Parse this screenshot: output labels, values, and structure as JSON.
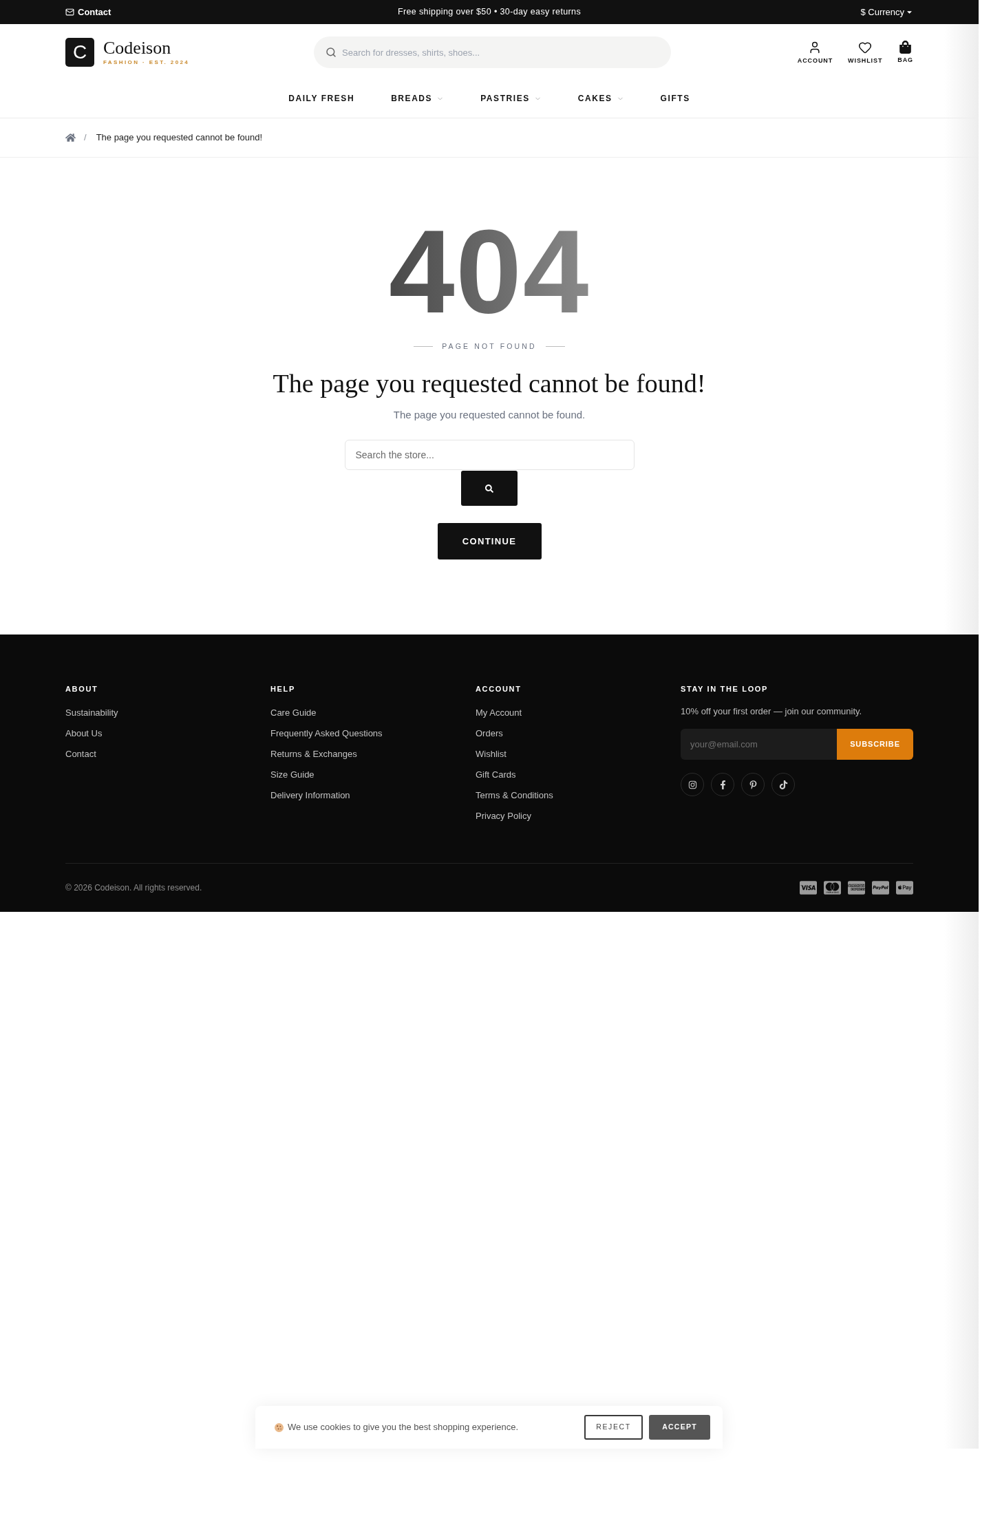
{
  "top_bar": {
    "contact": "Contact",
    "promo": "Free shipping over $50 • 30-day easy returns",
    "currency": "$ Currency"
  },
  "header": {
    "logo": {
      "letter": "C",
      "name": "Codeison",
      "tagline": "FASHION · EST. 2024"
    },
    "search": {
      "placeholder": "Search for dresses, shirts, shoes..."
    },
    "actions": [
      {
        "label": "ACCOUNT",
        "kind": "account"
      },
      {
        "label": "WISHLIST",
        "kind": "wishlist"
      },
      {
        "label": "BAG",
        "kind": "bag"
      }
    ]
  },
  "nav": [
    {
      "label": "DAILY FRESH",
      "dropdown": false
    },
    {
      "label": "BREADS",
      "dropdown": true
    },
    {
      "label": "PASTRIES",
      "dropdown": true
    },
    {
      "label": "CAKES",
      "dropdown": true
    },
    {
      "label": "GIFTS",
      "dropdown": false
    }
  ],
  "breadcrumb": {
    "separator": "/",
    "current": "The page you requested cannot be found!"
  },
  "error": {
    "code": "404",
    "eyebrow": "PAGE NOT FOUND",
    "title": "The page you requested cannot be found!",
    "message": "The page you requested cannot be found.",
    "search": {
      "placeholder": "Search the store..."
    },
    "continue_button": "CONTINUE"
  },
  "footer": {
    "columns": [
      {
        "heading": "ABOUT",
        "links": [
          "Sustainability",
          "About Us",
          "Contact"
        ]
      },
      {
        "heading": "HELP",
        "links": [
          "Care Guide",
          "Frequently Asked Questions",
          "Returns & Exchanges",
          "Size Guide",
          "Delivery Information"
        ]
      },
      {
        "heading": "ACCOUNT",
        "links": [
          "My Account",
          "Orders",
          "Wishlist",
          "Gift Cards",
          "Terms & Conditions",
          "Privacy Policy"
        ]
      }
    ],
    "newsletter": {
      "heading": "STAY IN THE LOOP",
      "text": "10% off your first order — join our community.",
      "email": {
        "placeholder": "your@email.com"
      },
      "button": "SUBSCRIBE"
    },
    "copyright": "© 2026 Codeison. All rights reserved."
  },
  "cookie_banner": {
    "text": "We use cookies to give you the best shopping experience.",
    "buttons": [
      {
        "label": "REJECT",
        "kind": "outline"
      },
      {
        "label": "ACCEPT",
        "kind": "solid"
      }
    ]
  }
}
